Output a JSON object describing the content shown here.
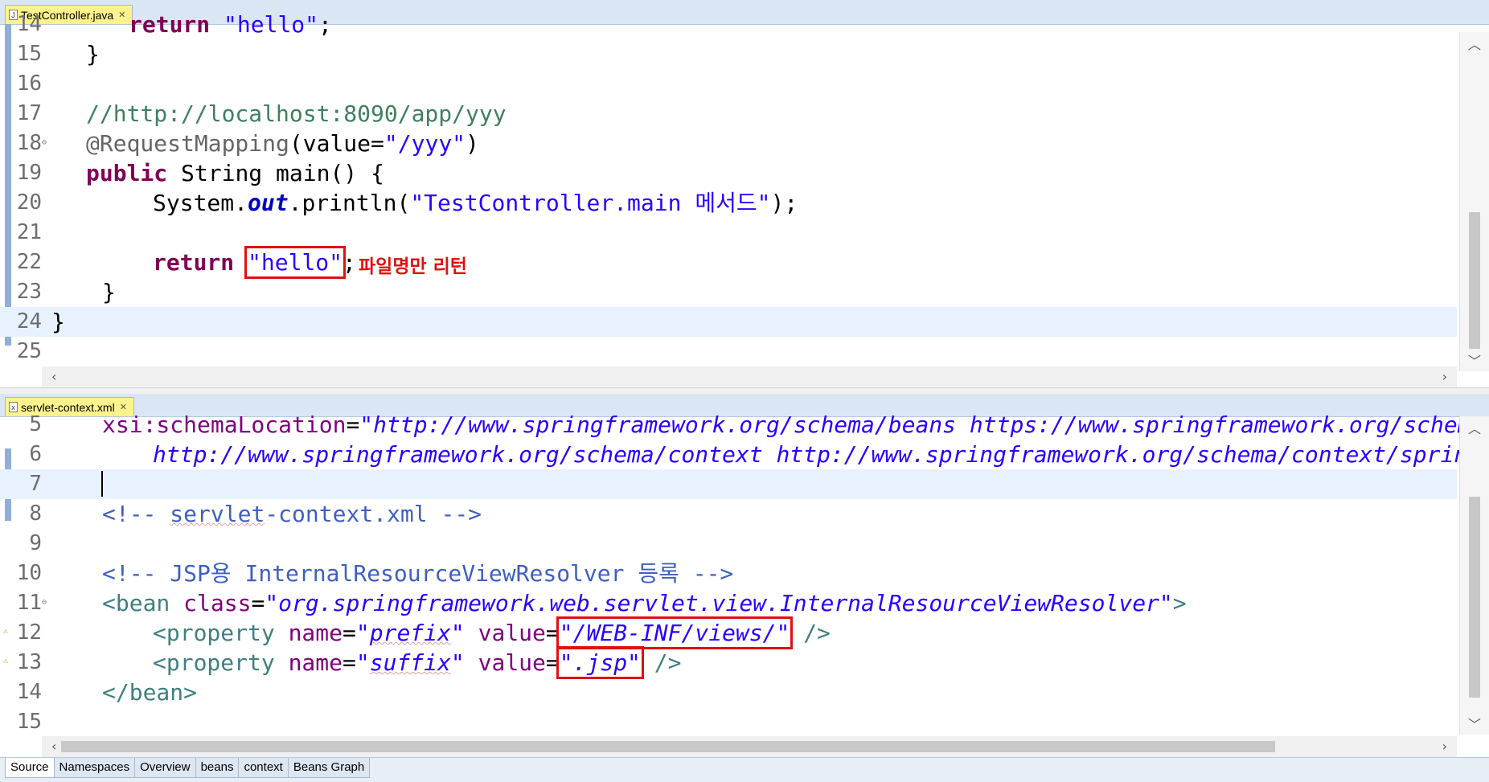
{
  "top_editor": {
    "tab_label": "TestController.java",
    "tab_icon": "java-file-icon",
    "lines": [
      {
        "num": "14",
        "text": "return \"hello\";"
      },
      {
        "num": "15",
        "text": "}"
      },
      {
        "num": "16",
        "text": ""
      },
      {
        "num": "17",
        "text": "//http://localhost:8090/app/yyy"
      },
      {
        "num": "18",
        "text": "@RequestMapping(value=\"/yyy\")"
      },
      {
        "num": "19",
        "text": "public String main() {"
      },
      {
        "num": "20",
        "text": "System.out.println(\"TestController.main 메서드\");"
      },
      {
        "num": "21",
        "text": ""
      },
      {
        "num": "22",
        "text": "return \"hello\";"
      },
      {
        "num": "23",
        "text": "}"
      },
      {
        "num": "24",
        "text": "}"
      },
      {
        "num": "25",
        "text": ""
      }
    ],
    "tokens": {
      "l14_kw": "return",
      "l14_str": "\"hello\"",
      "l14_end": ";",
      "l17": "//http://localhost:8090/app/yyy",
      "l18_ann": "@RequestMapping",
      "l18_a": "(value=",
      "l18_str": "\"/yyy\"",
      "l18_b": ")",
      "l19_kw": "public",
      "l19_rest": " String main() {",
      "l20_a": "System.",
      "l20_field": "out",
      "l20_b": ".println(",
      "l20_str": "\"TestController.main 메서드\"",
      "l20_c": ");",
      "l22_kw": "return",
      "l22_str": "\"hello\"",
      "l22_end": ";",
      "brace": "}"
    },
    "annotation": "파일명만 리턴"
  },
  "bottom_editor": {
    "tab_label": "servlet-context.xml",
    "tab_icon": "xml-file-icon",
    "lines": [
      {
        "num": "5"
      },
      {
        "num": "6"
      },
      {
        "num": "7"
      },
      {
        "num": "8"
      },
      {
        "num": "9"
      },
      {
        "num": "10"
      },
      {
        "num": "11"
      },
      {
        "num": "12"
      },
      {
        "num": "13"
      },
      {
        "num": "14"
      },
      {
        "num": "15"
      }
    ],
    "tokens": {
      "l5_attr": "xsi:schemaLocation",
      "l5_eq": "=",
      "l5_val": "\"http://www.springframework.org/schema/beans https://www.springframework.org/schema/bea",
      "l6_val": "http://www.springframework.org/schema/context http://www.springframework.org/schema/context/spring-con",
      "l8_a": "<!-- ",
      "l8_b": "servlet",
      "l8_c": "-context.xml -->",
      "l10": "<!-- JSP용 InternalResourceViewResolver 등록 -->",
      "l11_tag": "<bean",
      "l11_attr": " class",
      "l11_eq": "=",
      "l11_val": "\"org.springframework.web.servlet.view.InternalResourceViewResolver\"",
      "l11_end": ">",
      "l12_tag": "<property",
      "l12_attr1": " name",
      "l12_eq1": "=",
      "l12_q1": "\"",
      "l12_v1": "prefix",
      "l12_q2": "\"",
      "l12_attr2": " value",
      "l12_eq2": "=",
      "l12_v2": "\"/WEB-INF/views/\"",
      "l12_end": " />",
      "l13_tag": "<property",
      "l13_attr1": " name",
      "l13_eq1": "=",
      "l13_q1": "\"",
      "l13_v1": "suffix",
      "l13_q2": "\"",
      "l13_attr2": " value",
      "l13_eq2": "=",
      "l13_v2": "\".jsp\"",
      "l13_end": " />",
      "l14": "</bean>"
    }
  },
  "bottom_tabs": [
    {
      "label": "Source",
      "active": true
    },
    {
      "label": "Namespaces",
      "active": false
    },
    {
      "label": "Overview",
      "active": false
    },
    {
      "label": "beans",
      "active": false
    },
    {
      "label": "context",
      "active": false
    },
    {
      "label": "Beans Graph",
      "active": false
    }
  ],
  "colors": {
    "keyword": "#7f0055",
    "string": "#2a00ff",
    "comment": "#3f7f5f",
    "highlight_box": "#e01010",
    "current_line": "#e8f2fe",
    "tab_active": "#fcf38c"
  }
}
